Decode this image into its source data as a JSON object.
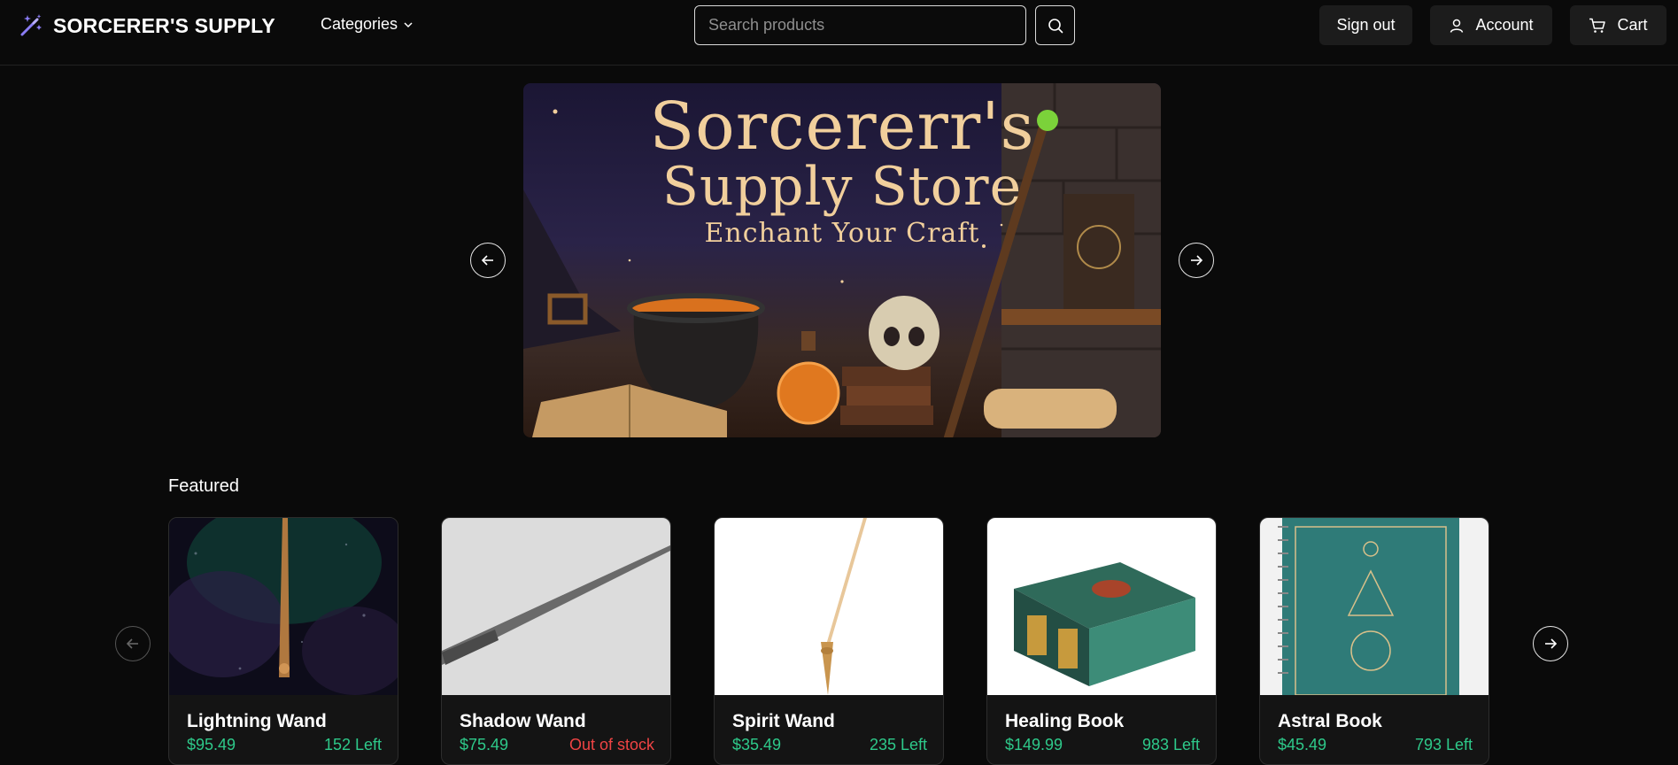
{
  "header": {
    "brand": "SORCERER'S SUPPLY",
    "categories_label": "Categories",
    "search_placeholder": "Search products",
    "signout_label": "Sign out",
    "account_label": "Account",
    "cart_label": "Cart"
  },
  "banner": {
    "title_line1": "Sorcererr's",
    "title_line2": "Supply Store",
    "subtitle": "Enchant Your Craft"
  },
  "featured": {
    "title": "Featured",
    "products": [
      {
        "name": "Lightning Wand",
        "price": "$95.49",
        "stock": "152 Left"
      },
      {
        "name": "Shadow Wand",
        "price": "$75.49",
        "stock": "Out of stock"
      },
      {
        "name": "Spirit Wand",
        "price": "$35.49",
        "stock": "235 Left"
      },
      {
        "name": "Healing Book",
        "price": "$149.99",
        "stock": "983 Left"
      },
      {
        "name": "Astral Book",
        "price": "$45.49",
        "stock": "793 Left"
      }
    ]
  },
  "colors": {
    "accent": "#7c6cf0",
    "price": "#2ec98a",
    "out_of_stock": "#ef4444"
  }
}
